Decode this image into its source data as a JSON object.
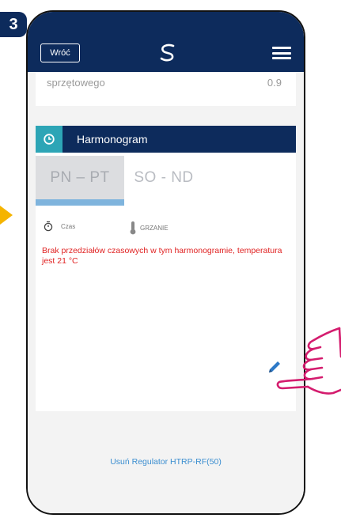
{
  "step_badge": "3",
  "header": {
    "back_label": "Wróć",
    "logo_icon": "brand-s-icon",
    "menu_icon": "hamburger-icon"
  },
  "info_row": {
    "label": "sprzętowego",
    "value": "0.9"
  },
  "schedule": {
    "title": "Harmonogram",
    "tabs": [
      {
        "label": "PN – PT",
        "active": true
      },
      {
        "label": "SO - ND",
        "active": false
      }
    ],
    "columns": {
      "time": "Czas",
      "heating": "GRZANIE"
    },
    "warning": "Brak przedziałów czasowych w tym harmonogramie, temperatura jest 21 °C"
  },
  "remove_label": "Usuń Regulator HTRP-RF(50)",
  "colors": {
    "navy": "#0d2b5c",
    "teal": "#2da5b6",
    "accent_blue": "#7fb4dd",
    "warning_red": "#e02222",
    "link_blue": "#3b8ed0",
    "hand_pink": "#d41c6e",
    "arrow_yellow": "#f5b400"
  }
}
